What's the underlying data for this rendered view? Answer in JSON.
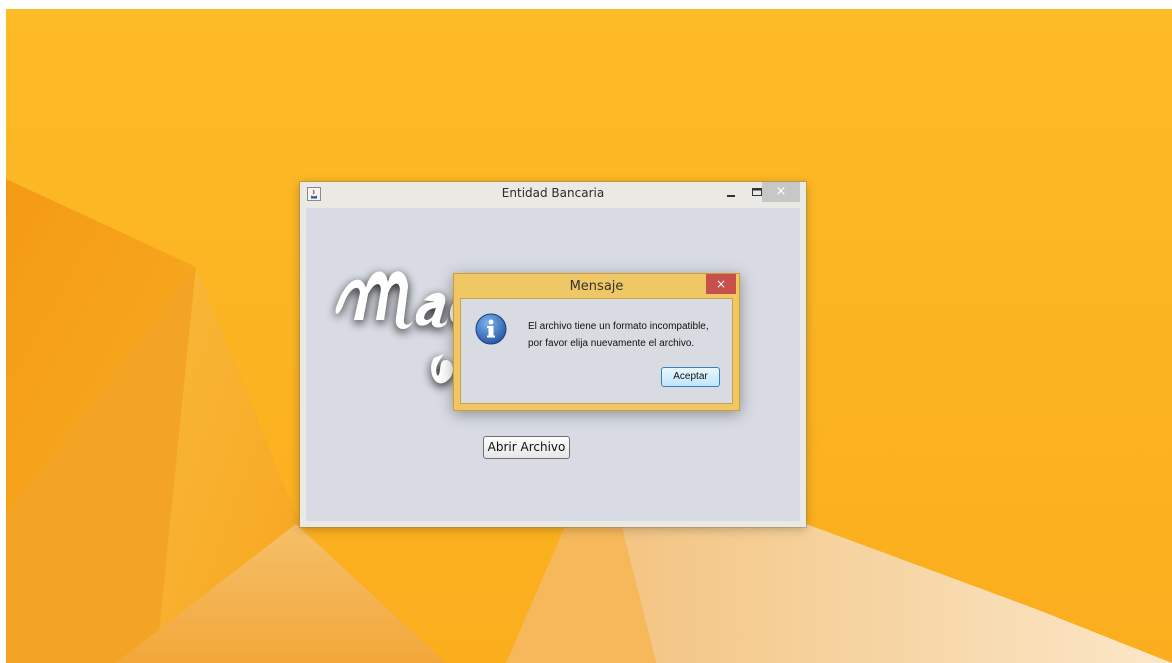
{
  "main_window": {
    "title": "Entidad Bancaria",
    "minimize_glyph": "–",
    "maximize_glyph": "□",
    "close_glyph": "×",
    "icon": "java-icon",
    "open_file_label": "Abrir Archivo"
  },
  "dialog": {
    "title": "Mensaje",
    "close_glyph": "×",
    "icon": "info-icon",
    "message_line1": "El archivo tiene un formato incompatible,",
    "message_line2": "por favor elija nuevamente el archivo.",
    "accept_label": "Aceptar"
  },
  "colors": {
    "desktop_accent": "#fbb31f",
    "dialog_frame": "#f0c765",
    "dialog_close": "#c7504b",
    "window_client": "#d8dbe3"
  }
}
